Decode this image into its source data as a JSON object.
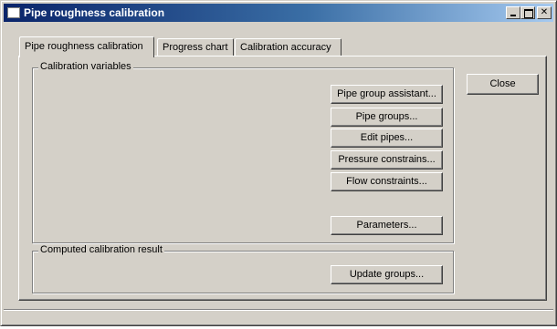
{
  "window": {
    "title": "Pipe roughness calibration",
    "accent_color": "#0a246a",
    "face_color": "#d4d0c8",
    "caption_buttons": [
      "minimize-icon",
      "maximize-icon",
      "close-icon"
    ]
  },
  "tabs": [
    {
      "label": "Pipe roughness calibration",
      "active": true
    },
    {
      "label": "Progress chart",
      "active": false
    },
    {
      "label": "Calibration accuracy",
      "active": false
    }
  ],
  "calibration_variables": {
    "label": "Calibration variables",
    "buttons": {
      "pipe_group_assistant": "Pipe group assistant...",
      "pipe_groups": "Pipe groups...",
      "edit_pipes": "Edit pipes...",
      "pressure_constrains": "Pressure constrains...",
      "flow_constraints": "Flow constraints...",
      "parameters": "Parameters..."
    }
  },
  "computed_result": {
    "label": "Computed calibration result",
    "update_groups": "Update groups..."
  },
  "close_label": "Close"
}
